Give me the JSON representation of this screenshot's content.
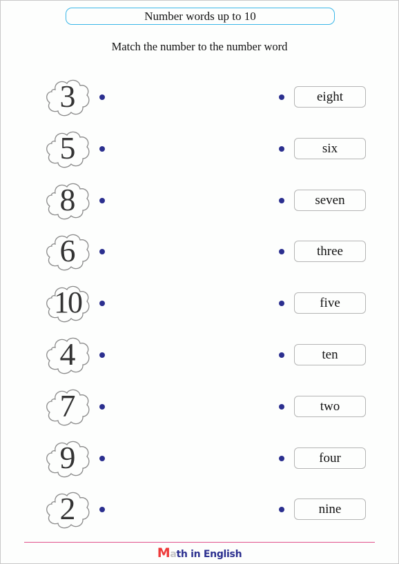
{
  "title": "Number words up to 10",
  "instruction": "Match the number to the number word",
  "colors": {
    "title_border": "#38b6e8",
    "dot": "#2b2f8f",
    "footer_line": "#e0508a",
    "brand_m": "#ee3a3a",
    "brand_a": "#c4c4c4",
    "brand_text": "#2b2f8f"
  },
  "rows": [
    {
      "number": "3",
      "word": "eight"
    },
    {
      "number": "5",
      "word": "six"
    },
    {
      "number": "8",
      "word": "seven"
    },
    {
      "number": "6",
      "word": "three"
    },
    {
      "number": "10",
      "word": "five"
    },
    {
      "number": "4",
      "word": "ten"
    },
    {
      "number": "7",
      "word": "two"
    },
    {
      "number": "9",
      "word": "four"
    },
    {
      "number": "2",
      "word": "nine"
    }
  ],
  "footer": {
    "brand_first": "M",
    "brand_second": "a",
    "brand_rest": "th in English"
  }
}
